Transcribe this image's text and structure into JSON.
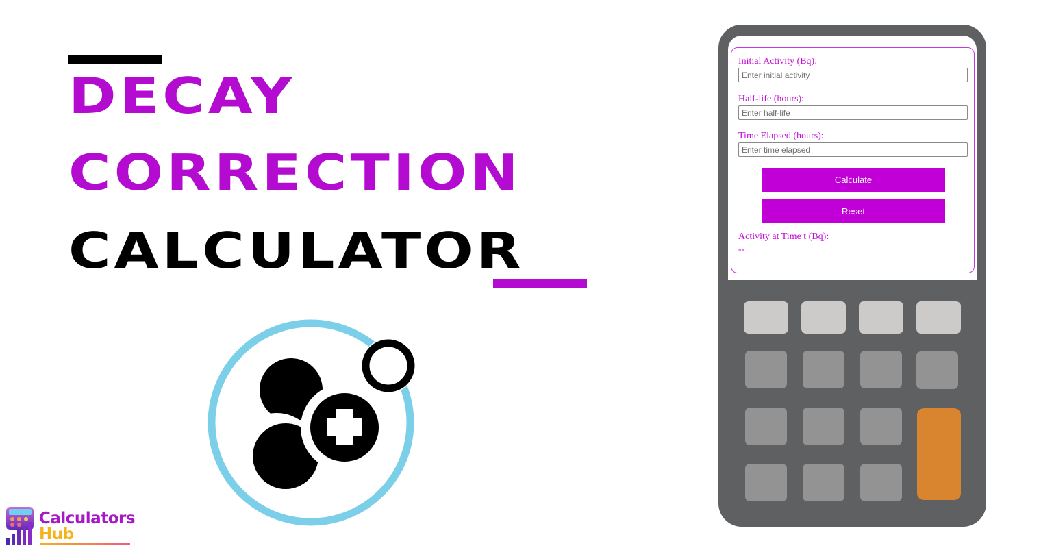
{
  "hero": {
    "title_line1": "DECAY",
    "title_line2": "CORRECTION",
    "title_line3": "CALCULATOR",
    "accent_color": "#b30bcf",
    "icon": "radioactive-decay-atom-icon"
  },
  "brand": {
    "name_line1": "Calculators",
    "name_line2": "Hub",
    "icon": "calculator-bars-logo-icon"
  },
  "calculator": {
    "fields": [
      {
        "label": "Initial Activity (Bq):",
        "placeholder": "Enter initial activity",
        "value": ""
      },
      {
        "label": "Half-life (hours):",
        "placeholder": "Enter half-life",
        "value": ""
      },
      {
        "label": "Time Elapsed (hours):",
        "placeholder": "Enter time elapsed",
        "value": ""
      }
    ],
    "calculate_label": "Calculate",
    "reset_label": "Reset",
    "result_label": "Activity at Time t (Bq):",
    "result_value": "--",
    "button_color": "#c000d6",
    "keypad_accent_color": "#d98530"
  }
}
